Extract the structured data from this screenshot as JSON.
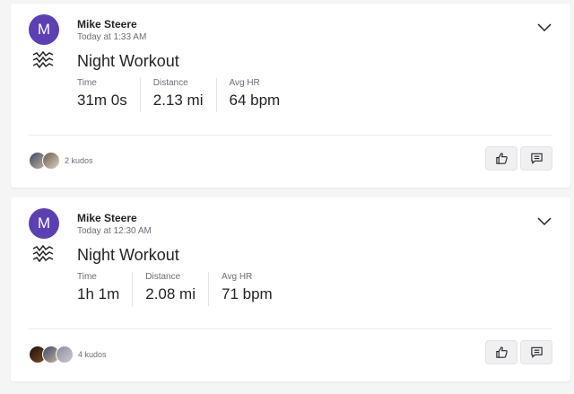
{
  "colors": {
    "avatar": "#5b3fb3",
    "accent": "#242428"
  },
  "icons": {
    "sport": "workout-wave-icon",
    "menu": "chevron-down-icon",
    "kudos": "thumbs-up-icon",
    "comment": "comment-icon"
  },
  "activities": [
    {
      "avatar_initial": "M",
      "athlete": "Mike Steere",
      "timestamp": "Today at 1:33 AM",
      "title": "Night Workout",
      "stats": [
        {
          "label": "Time",
          "value": "31m 0s"
        },
        {
          "label": "Distance",
          "value": "2.13 mi"
        },
        {
          "label": "Avg HR",
          "value": "64 bpm"
        }
      ],
      "kudos_text": "2 kudos"
    },
    {
      "avatar_initial": "M",
      "athlete": "Mike Steere",
      "timestamp": "Today at 12:30 AM",
      "title": "Night Workout",
      "stats": [
        {
          "label": "Time",
          "value": "1h 1m"
        },
        {
          "label": "Distance",
          "value": "2.08 mi"
        },
        {
          "label": "Avg HR",
          "value": "71 bpm"
        }
      ],
      "kudos_text": "4 kudos"
    }
  ]
}
